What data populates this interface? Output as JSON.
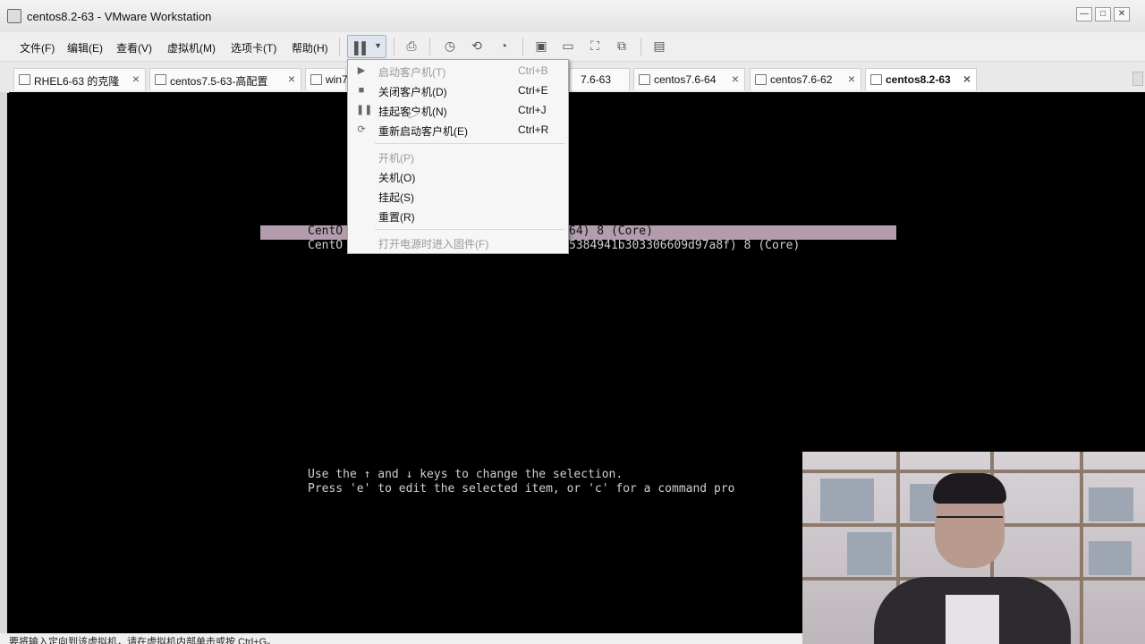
{
  "window": {
    "title": "centos8.2-63 - VMware Workstation",
    "controls": [
      "—",
      "□",
      "✕"
    ]
  },
  "menubar": {
    "items": [
      "文件(F)",
      "编辑(E)",
      "查看(V)",
      "虚拟机(M)",
      "选项卡(T)",
      "帮助(H)"
    ]
  },
  "toolbar": {
    "icons": [
      "pause-icon",
      "send-keys-icon",
      "snapshot-icon",
      "revert-snapshot-icon",
      "snapshot-manager-icon",
      "console-view-icon",
      "thumbnail-icon",
      "fullscreen-icon",
      "unity-icon",
      "library-icon"
    ]
  },
  "tabs": [
    {
      "label": "RHEL6-63 的克隆",
      "active": false
    },
    {
      "label": "centos7.5-63-高配置",
      "active": false
    },
    {
      "label": "win7",
      "active": false
    },
    {
      "label": "7.6-63",
      "active": false
    },
    {
      "label": "centos7.6-64",
      "active": false
    },
    {
      "label": "centos7.6-62",
      "active": false
    },
    {
      "label": "centos8.2-63",
      "active": true
    }
  ],
  "power_menu": {
    "items": [
      {
        "label": "启动客户机(T)",
        "shortcut": "Ctrl+B",
        "disabled": true,
        "icon": "play-icon"
      },
      {
        "label": "关闭客户机(D)",
        "shortcut": "Ctrl+E",
        "disabled": false,
        "icon": "stop-icon"
      },
      {
        "label": "挂起客户机(N)",
        "shortcut": "Ctrl+J",
        "disabled": false,
        "icon": "pause-icon"
      },
      {
        "label": "重新启动客户机(E)",
        "shortcut": "Ctrl+R",
        "disabled": false,
        "icon": "restart-icon"
      },
      {
        "label": "开机(P)",
        "shortcut": "",
        "disabled": true,
        "icon": ""
      },
      {
        "label": "关机(O)",
        "shortcut": "",
        "disabled": false,
        "icon": ""
      },
      {
        "label": "挂起(S)",
        "shortcut": "",
        "disabled": false,
        "icon": ""
      },
      {
        "label": "重置(R)",
        "shortcut": "",
        "disabled": false,
        "icon": ""
      },
      {
        "label": "打开电源时进入固件(F)",
        "shortcut": "",
        "disabled": true,
        "icon": ""
      }
    ]
  },
  "console": {
    "grub_entry_1_start": "CentO",
    "grub_entry_1_end": "64) 8 (Core)",
    "grub_entry_2_start": "CentO",
    "grub_entry_2_end": "5384941b303306609d97a8f) 8 (Core)",
    "help_line_1": "Use the ↑ and ↓ keys to change the selection.",
    "help_line_2": "Press 'e' to edit the selected item, or 'c' for a command pro"
  },
  "statusbar": {
    "text": "要将输入定向到该虚拟机，请在虚拟机内部单击或按 Ctrl+G。"
  },
  "colors": {
    "grub_highlight": "#b39cad",
    "console_bg": "#000000",
    "console_text": "#cfcfcf"
  }
}
